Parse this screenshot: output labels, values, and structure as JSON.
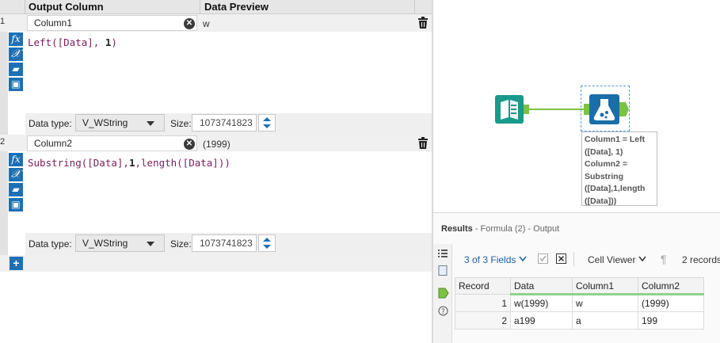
{
  "config": {
    "headers": {
      "output_column": "Output Column",
      "data_preview": "Data Preview"
    },
    "formulas": [
      {
        "row_number": "1",
        "name": "Column1",
        "preview": "w",
        "expression_parts": [
          "Left([Data], ",
          "1",
          ")"
        ],
        "data_type_label": "Data type:",
        "data_type": "V_WString",
        "size_label": "Size:",
        "size": "1073741823"
      },
      {
        "row_number": "2",
        "name": "Column2",
        "preview": "(1999)",
        "expression_parts": [
          "Substring([Data],",
          "1",
          ",length([Data]))"
        ],
        "data_type_label": "Data type:",
        "data_type": "V_WString",
        "size_label": "Size:",
        "size": "1073741823"
      }
    ],
    "side_icons": [
      "fx-icon",
      "variable-icon",
      "open-folder-icon",
      "save-icon"
    ],
    "add_button": "+"
  },
  "canvas": {
    "annotation_lines": [
      "Column1 = Left",
      "([Data], 1)",
      "Column2 =",
      "Substring",
      "([Data],1,length",
      "([Data]))"
    ],
    "colors": {
      "input_tool": "#1a9a8a",
      "formula_tool": "#1a6fa8",
      "connector": "#7dc242"
    }
  },
  "results": {
    "title_bold": "Results",
    "title_rest": " - Formula (2) - Output",
    "fields_label": "3 of 3 Fields",
    "cell_viewer_label": "Cell Viewer",
    "records_label": "2 records",
    "columns": [
      "Record",
      "Data",
      "Column1",
      "Column2"
    ],
    "rows": [
      [
        "1",
        "w(1999)",
        "w",
        "(1999)"
      ],
      [
        "2",
        "a199",
        "a",
        "199"
      ]
    ]
  }
}
